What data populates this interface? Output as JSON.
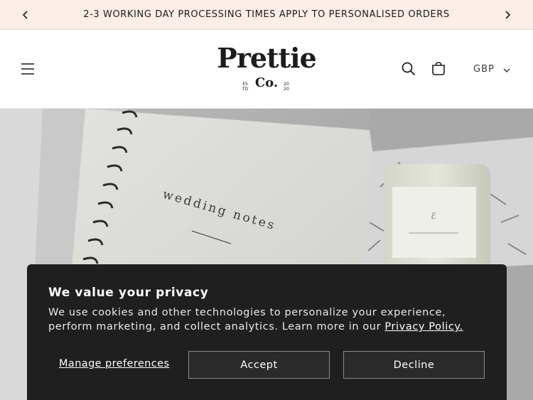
{
  "announcement": {
    "text": "2-3 WORKING DAY PROCESSING TIMES APPLY TO PERSONALISED ORDERS",
    "prev_icon": "chevron-left-icon",
    "next_icon": "chevron-right-icon"
  },
  "header": {
    "logo": {
      "main": "Prettie",
      "sub": "Co.",
      "est_left": "ES\nTD",
      "est_right": "20\n20"
    },
    "icons": [
      "menu-icon",
      "search-icon",
      "cart-icon",
      "chevron-down-icon"
    ],
    "currency": "GBP"
  },
  "hero": {
    "notebook_text": "wedding notes",
    "image": "photo of a wedding notes notebook and a candle in a gift box"
  },
  "cookie_banner": {
    "title": "We value your privacy",
    "body_text": "We use cookies and other technologies to personalize your experience, perform marketing, and collect analytics. Learn more in our ",
    "link_text": "Privacy Policy.",
    "manage_label": "Manage preferences",
    "accept_label": "Accept",
    "decline_label": "Decline"
  },
  "colors": {
    "announcement_bg": "#fdeee6",
    "banner_bg": "#1f1f1f",
    "text": "#1c1c1c"
  }
}
